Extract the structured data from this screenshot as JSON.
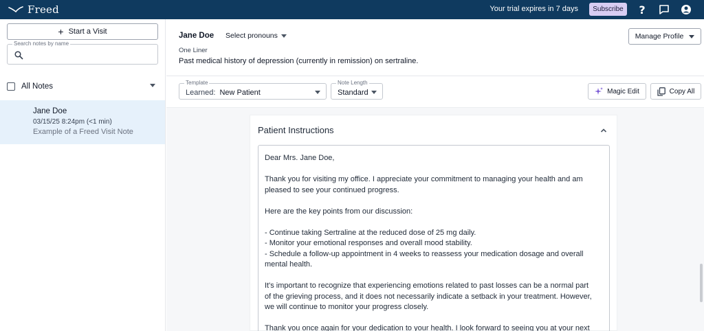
{
  "topbar": {
    "logo_text": "Freed",
    "trial_text": "Your trial expires in 7 days",
    "subscribe_label": "Subscribe",
    "icons": [
      "help-icon",
      "chat-icon",
      "account-icon"
    ],
    "help_glyph": "?"
  },
  "sidebar": {
    "start_visit_label": "Start a Visit",
    "search": {
      "label": "Search notes by name",
      "value": ""
    },
    "all_notes_label": "All Notes",
    "notes": [
      {
        "name": "Jane Doe",
        "date": "03/15/25 8:24pm (<1 min)",
        "description": "Example of a Freed Visit Note"
      }
    ]
  },
  "patient": {
    "name": "Jane Doe",
    "pronouns_label": "Select pronouns",
    "manage_profile_label": "Manage Profile",
    "one_liner_label": "One Liner",
    "one_liner": "Past medical history of depression (currently in remission) on sertraline."
  },
  "toolbar": {
    "template": {
      "label": "Template",
      "prefix": "Learned:",
      "value": "New Patient"
    },
    "note_length": {
      "label": "Note Length",
      "value": "Standard"
    },
    "magic_edit_label": "Magic Edit",
    "copy_all_label": "Copy All"
  },
  "section": {
    "title": "Patient Instructions",
    "lines": [
      "Dear Mrs. Jane Doe,",
      "",
      "Thank you for visiting my office. I appreciate your commitment to managing your health and am",
      "pleased to see your continued progress.",
      "",
      "Here are the key points from our discussion:",
      "",
      "- Continue taking Sertraline at the reduced dose of 25 mg daily.",
      "- Monitor your emotional responses and overall mood stability.",
      "- Schedule a follow-up appointment in 4 weeks to reassess your medication dosage and overall",
      "mental health.",
      "",
      "It's important to recognize that experiencing emotions related to past losses can be a normal part",
      "of the grieving process, and it does not necessarily indicate a setback in your treatment. However,",
      "we will continue to monitor your progress closely.",
      "",
      "Thank you once again for your dedication to your health. I look forward to seeing you at your next"
    ]
  },
  "colors": {
    "topbar": "#0f3a5f",
    "subscribe_bg": "#d8cdf3",
    "selected_note_bg": "#e6f1fb",
    "magic_accent": "#7c5cd6"
  }
}
